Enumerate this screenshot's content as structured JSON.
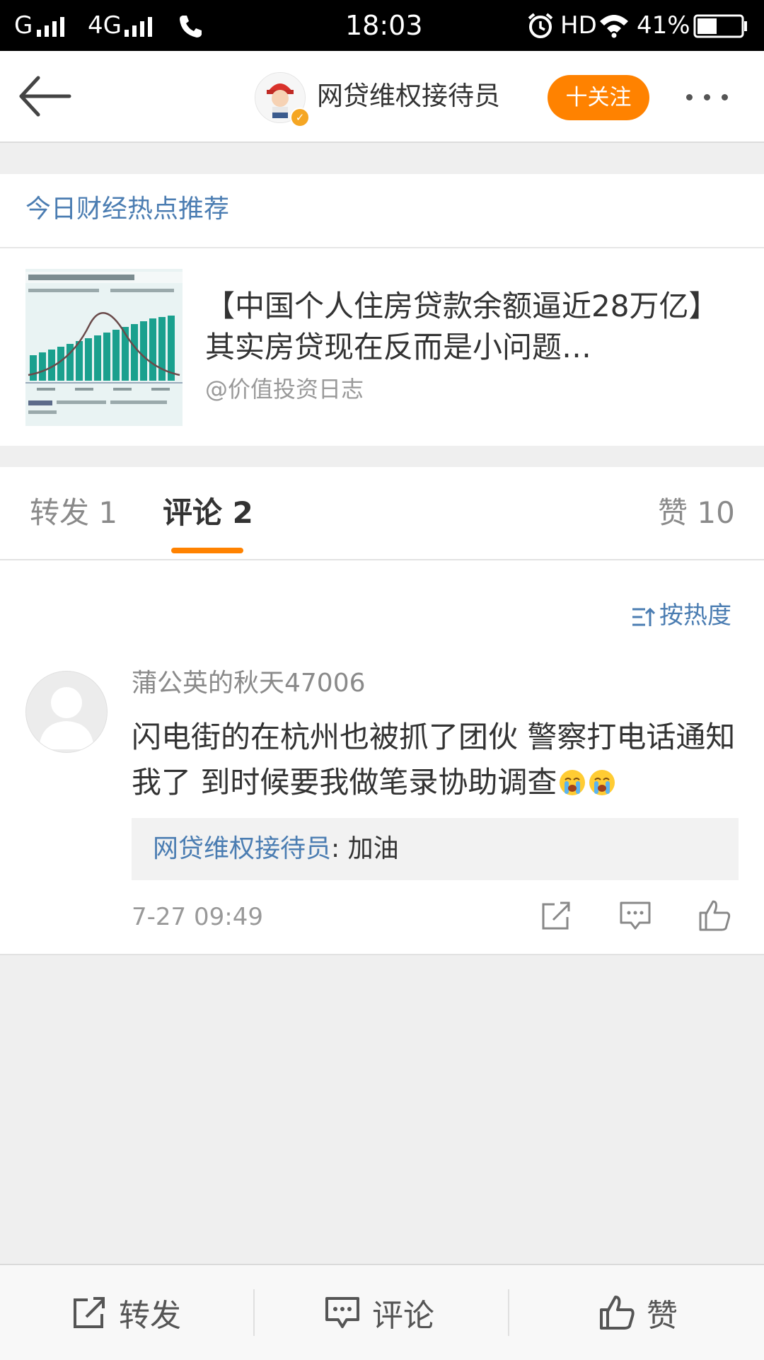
{
  "status_bar": {
    "carrier1": "G",
    "carrier2": "4G",
    "time": "18:03",
    "hd": "HD",
    "battery": "41%"
  },
  "header": {
    "title": "网贷维权接待员",
    "follow_label": "十关注"
  },
  "recommend": {
    "title": "今日财经热点推荐",
    "headline": "【中国个人住房贷款余额逼近28万亿】其实房贷现在反而是小问题…",
    "source": "@价值投资日志"
  },
  "tabs": {
    "repost": "转发 1",
    "comment": "评论 2",
    "like": "赞 10"
  },
  "comments": {
    "sort_label": "按热度",
    "items": [
      {
        "user": "蒲公英的秋天47006",
        "text": "闪电街的在杭州也被抓了团伙 警察打电话通知我了 到时候要我做笔录协助调查",
        "reply_user": "网贷维权接待员",
        "reply_text": ": 加油",
        "time": "7-27 09:49"
      }
    ]
  },
  "bottom_bar": {
    "repost": "转发",
    "comment": "评论",
    "like": "赞"
  },
  "colors": {
    "accent_orange": "#ff8200",
    "link_blue": "#4b7db2"
  },
  "icons": [
    "back-arrow-icon",
    "signal-icon",
    "phone-icon",
    "alarm-icon",
    "wifi-icon",
    "battery-icon",
    "verified-icon",
    "more-icon",
    "sort-icon",
    "crying-emoji-icon",
    "share-icon",
    "comment-icon",
    "like-icon"
  ]
}
